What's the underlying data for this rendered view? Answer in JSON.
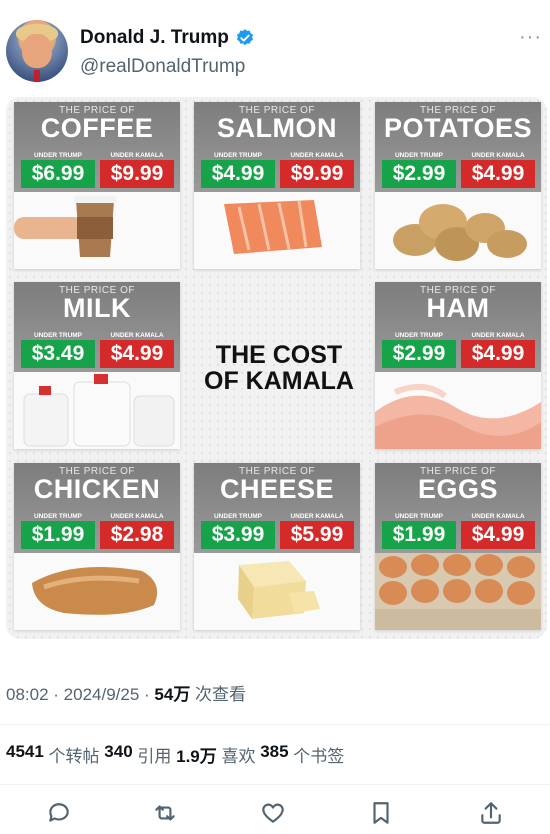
{
  "author": {
    "display_name": "Donald J. Trump",
    "handle": "@realDonaldTrump",
    "verified": true
  },
  "more_icon": "···",
  "infographic": {
    "center_title_line1": "THE COST",
    "center_title_line2": "OF KAMALA",
    "label_trump": "UNDER TRUMP",
    "label_kamala": "UNDER KAMALA",
    "price_of": "THE PRICE OF",
    "items": [
      {
        "name": "COFFEE",
        "trump": "$6.99",
        "kamala": "$9.99"
      },
      {
        "name": "SALMON",
        "trump": "$4.99",
        "kamala": "$9.99"
      },
      {
        "name": "POTATOES",
        "trump": "$2.99",
        "kamala": "$4.99"
      },
      {
        "name": "MILK",
        "trump": "$3.49",
        "kamala": "$4.99"
      },
      {
        "name": "HAM",
        "trump": "$2.99",
        "kamala": "$4.99"
      },
      {
        "name": "CHICKEN",
        "trump": "$1.99",
        "kamala": "$2.98"
      },
      {
        "name": "CHEESE",
        "trump": "$3.99",
        "kamala": "$5.99"
      },
      {
        "name": "EGGS",
        "trump": "$1.99",
        "kamala": "$4.99"
      }
    ]
  },
  "meta": {
    "time": "08:02",
    "sep1": " · ",
    "date": "2024/9/25",
    "sep2": " · ",
    "views": "54万",
    "views_label": " 次查看"
  },
  "stats": {
    "reposts": "4541",
    "reposts_label": " 个转帖 ",
    "quotes": "340",
    "quotes_label": " 引用 ",
    "likes": "1.9万",
    "likes_label": " 喜欢 ",
    "bookmarks": "385",
    "bookmarks_label": " 个书签"
  },
  "actions": [
    "reply-icon",
    "repost-icon",
    "like-icon",
    "bookmark-icon",
    "share-icon"
  ],
  "colors": {
    "trump_green": "#16a34a",
    "kamala_red": "#d42a2a",
    "verified_blue": "#1d9bf0"
  }
}
